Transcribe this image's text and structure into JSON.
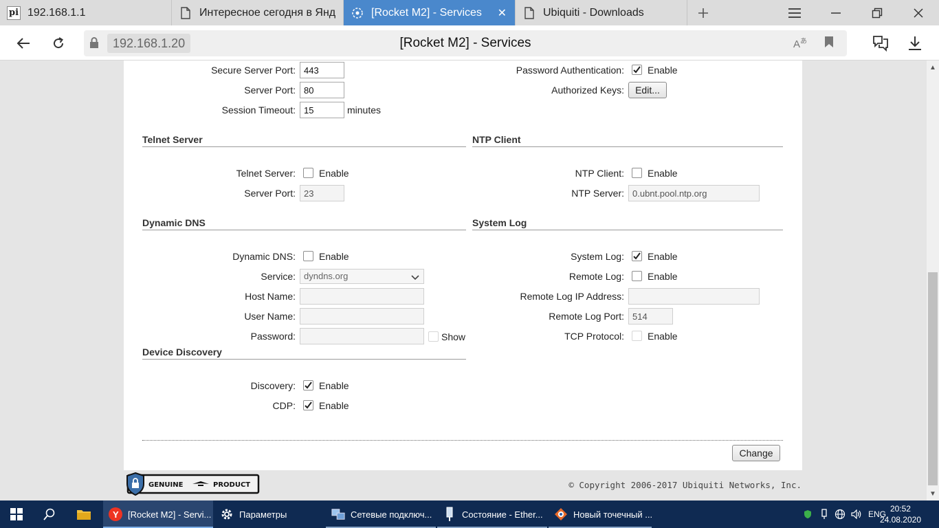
{
  "browser": {
    "tabs": [
      {
        "label": "192.168.1.1",
        "favicon": "pi-favicon",
        "active": false
      },
      {
        "label": "Интересное сегодня в Янд",
        "favicon": "page-icon",
        "active": false
      },
      {
        "label": "[Rocket M2] - Services",
        "favicon": "ubnt-icon",
        "active": true
      },
      {
        "label": "Ubiquiti - Downloads",
        "favicon": "page-icon",
        "active": false
      }
    ],
    "url_host": "192.168.1.20",
    "page_title": "[Rocket M2] - Services",
    "accent_color": "#4a88cc"
  },
  "ssh": {
    "secure_port_label": "Secure Server Port:",
    "secure_port_value": "443",
    "server_port_label": "Server Port:",
    "server_port_value": "80",
    "session_timeout_label": "Session Timeout:",
    "session_timeout_value": "15",
    "session_timeout_unit": "minutes",
    "password_auth_label": "Password Authentication:",
    "password_auth_enable": "Enable",
    "password_auth_checked": true,
    "authorized_keys_label": "Authorized Keys:",
    "authorized_keys_button": "Edit..."
  },
  "telnet": {
    "title": "Telnet Server",
    "server_label": "Telnet Server:",
    "enable_label": "Enable",
    "checked": false,
    "port_label": "Server Port:",
    "port_value": "23"
  },
  "ntp": {
    "title": "NTP Client",
    "client_label": "NTP Client:",
    "enable_label": "Enable",
    "checked": false,
    "server_label": "NTP Server:",
    "server_value": "0.ubnt.pool.ntp.org"
  },
  "ddns": {
    "title": "Dynamic DNS",
    "ddns_label": "Dynamic DNS:",
    "enable_label": "Enable",
    "checked": false,
    "service_label": "Service:",
    "service_value": "dyndns.org",
    "host_label": "Host Name:",
    "host_value": "",
    "user_label": "User Name:",
    "user_value": "",
    "password_label": "Password:",
    "password_value": "",
    "show_label": "Show"
  },
  "syslog": {
    "title": "System Log",
    "system_log_label": "System Log:",
    "system_log_enable": "Enable",
    "system_log_checked": true,
    "remote_log_label": "Remote Log:",
    "remote_log_enable": "Enable",
    "remote_log_checked": false,
    "remote_ip_label": "Remote Log IP Address:",
    "remote_ip_value": "",
    "remote_port_label": "Remote Log Port:",
    "remote_port_value": "514",
    "tcp_label": "TCP Protocol:",
    "tcp_enable": "Enable",
    "tcp_checked": false
  },
  "discovery": {
    "title": "Device Discovery",
    "discovery_label": "Discovery:",
    "discovery_enable": "Enable",
    "discovery_checked": true,
    "cdp_label": "CDP:",
    "cdp_enable": "Enable",
    "cdp_checked": true
  },
  "actions": {
    "change_button": "Change"
  },
  "footer": {
    "badge_left": "GENUINE",
    "badge_right": "PRODUCT",
    "copyright": "© Copyright 2006-2017 Ubiquiti Networks, Inc."
  },
  "taskbar": {
    "apps": [
      {
        "label": "[Rocket M2] - Servi...",
        "icon": "yandex-browser-icon",
        "active": true
      },
      {
        "label": "Параметры",
        "icon": "gear-icon",
        "active": false
      },
      {
        "label": "Сетевые подключ...",
        "icon": "network-connections-icon",
        "active": false
      },
      {
        "label": "Состояние - Ether...",
        "icon": "network-status-icon",
        "active": false
      },
      {
        "label": "Новый точечный ...",
        "icon": "image-editor-icon",
        "active": false
      }
    ],
    "language": "ENG",
    "time": "20:52",
    "date": "24.08.2020"
  }
}
